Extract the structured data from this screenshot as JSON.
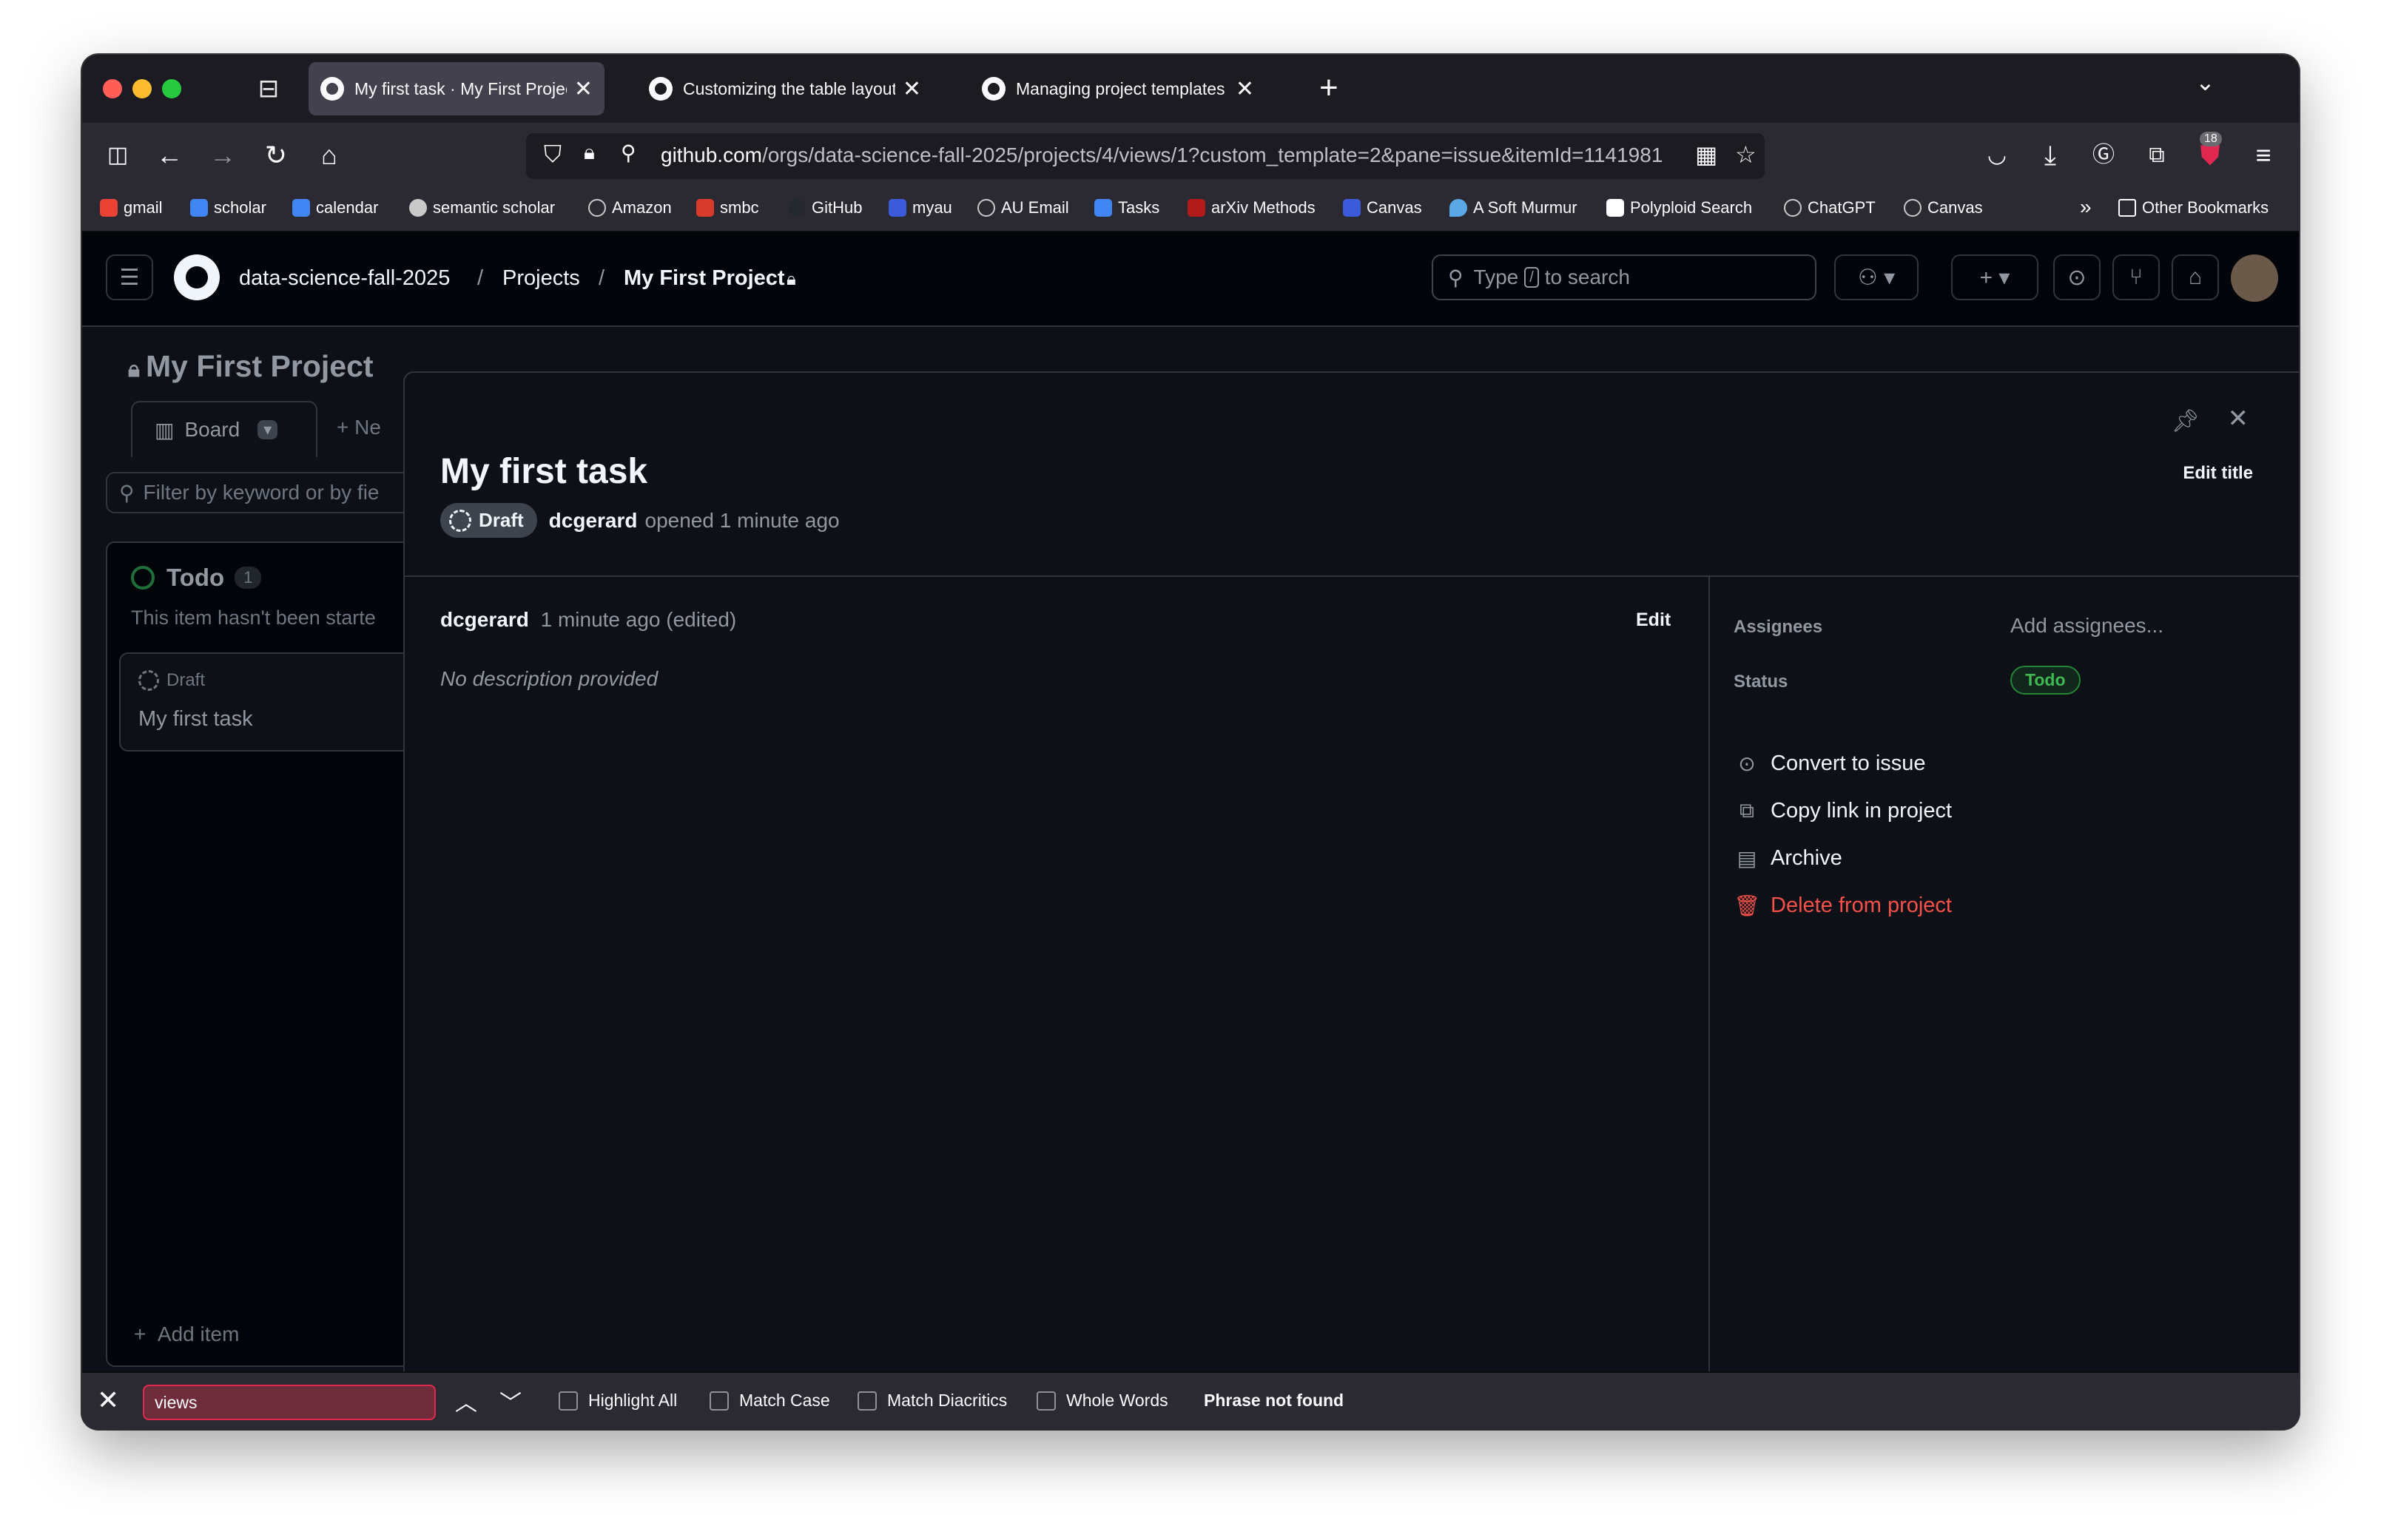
{
  "browser": {
    "tabs": [
      {
        "label": "My first task · My First Project",
        "active": true
      },
      {
        "label": "Customizing the table layout - G",
        "active": false
      },
      {
        "label": "Managing project templates in y",
        "active": false
      }
    ],
    "url_host": "github.com",
    "url_path": "/orgs/data-science-fall-2025/projects/4/views/1?custom_template=2&pane=issue&itemId=1141981",
    "extension_badge": "18",
    "bookmarks": [
      {
        "label": "gmail",
        "color": "#ea4335"
      },
      {
        "label": "scholar",
        "color": "#4285f4"
      },
      {
        "label": "calendar",
        "color": "#4285f4"
      },
      {
        "label": "semantic scholar",
        "color": "#c9c9c9"
      },
      {
        "label": "Amazon",
        "color": "#c9c9c9"
      },
      {
        "label": "smbc",
        "color": "#d83a2c"
      },
      {
        "label": "GitHub",
        "color": "#24292f"
      },
      {
        "label": "myau",
        "color": "#3b5bdb"
      },
      {
        "label": "AU Email",
        "color": "#c9c9c9"
      },
      {
        "label": "Tasks",
        "color": "#4285f4"
      },
      {
        "label": "arXiv Methods",
        "color": "#b31b1b"
      },
      {
        "label": "Canvas",
        "color": "#3b5bdb"
      },
      {
        "label": "A Soft Murmur",
        "color": "#5aa9e6"
      },
      {
        "label": "Polyploid Search",
        "color": "#ffffff"
      },
      {
        "label": "ChatGPT",
        "color": "#c9c9c9"
      },
      {
        "label": "Canvas",
        "color": "#c9c9c9"
      }
    ],
    "other_bookmarks": "Other Bookmarks"
  },
  "header": {
    "org": "data-science-fall-2025",
    "projects": "Projects",
    "project": "My First Project",
    "search_prefix": "Type",
    "search_key": "/",
    "search_suffix": "to search"
  },
  "board": {
    "title": "My First Project",
    "view_tab": "Board",
    "new_view": "Ne",
    "filter_placeholder": "Filter by keyword or by fie",
    "column": {
      "name": "Todo",
      "count": "1",
      "description": "This item hasn't been starte",
      "card": {
        "badge": "Draft",
        "title": "My first task"
      },
      "add_item": "Add item"
    }
  },
  "panel": {
    "title": "My first task",
    "edit_title": "Edit title",
    "draft_label": "Draft",
    "author": "dcgerard",
    "opened_text": "opened 1 minute ago",
    "comment": {
      "author": "dcgerard",
      "time": "1 minute ago (edited)",
      "edit": "Edit",
      "body": "No description provided"
    },
    "sidebar": {
      "assignees_label": "Assignees",
      "assignees_value": "Add assignees...",
      "status_label": "Status",
      "status_value": "Todo",
      "actions": [
        {
          "label": "Convert to issue",
          "icon": "issue-opened-icon"
        },
        {
          "label": "Copy link in project",
          "icon": "copy-icon"
        },
        {
          "label": "Archive",
          "icon": "archive-icon"
        },
        {
          "label": "Delete from project",
          "icon": "trash-icon"
        }
      ]
    }
  },
  "findbar": {
    "query": "views",
    "options": [
      "Highlight All",
      "Match Case",
      "Match Diacritics",
      "Whole Words"
    ],
    "status": "Phrase not found"
  }
}
